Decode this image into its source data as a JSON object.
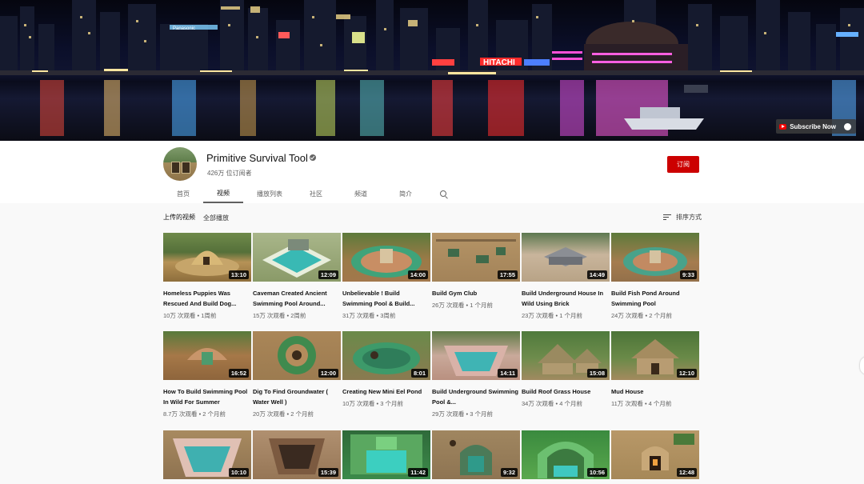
{
  "banner": {
    "subscribe_now_label": "Subscribe Now",
    "sign_hitachi": "HITACHI",
    "sign_panasonic": "Panasonic"
  },
  "channel": {
    "name": "Primitive Survival Tool",
    "subscribers": "426万 位订阅者",
    "subscribe_label": "订阅",
    "accent_color": "#cc0000"
  },
  "tabs": [
    {
      "label": "首页"
    },
    {
      "label": "视频",
      "active": true
    },
    {
      "label": "播放列表"
    },
    {
      "label": "社区"
    },
    {
      "label": "频道"
    },
    {
      "label": "简介"
    }
  ],
  "section": {
    "title": "上传的视频",
    "play_all": "全部播放",
    "sort_label": "排序方式"
  },
  "videos": [
    {
      "title": "Homeless Puppies Was Rescued And Build Dog...",
      "meta": "10万 次观看 • 1周前",
      "duration": "13:10"
    },
    {
      "title": "Caveman Created Ancient Swimming Pool Around...",
      "meta": "15万 次观看 • 2周前",
      "duration": "12:09"
    },
    {
      "title": "Unbelievable ! Build Swimming Pool & Build...",
      "meta": "31万 次观看 • 3周前",
      "duration": "14:00"
    },
    {
      "title": "Build Gym Club",
      "meta": "26万 次观看 • 1 个月前",
      "duration": "17:55"
    },
    {
      "title": "Build Underground House In Wild Using Brick",
      "meta": "23万 次观看 • 1 个月前",
      "duration": "14:49"
    },
    {
      "title": "Build Fish Pond Around Swimming Pool",
      "meta": "24万 次观看 • 2 个月前",
      "duration": "9:33"
    },
    {
      "title": "How To Build Swimming Pool In Wild For Summer",
      "meta": "8.7万 次观看 • 2 个月前",
      "duration": "16:52"
    },
    {
      "title": "Dig To Find Groundwater ( Water Well )",
      "meta": "20万 次观看 • 2 个月前",
      "duration": "12:00"
    },
    {
      "title": "Creating New Mini Eel Pond",
      "meta": "10万 次观看 • 3 个月前",
      "duration": "8:01"
    },
    {
      "title": "Build Underground Swimming Pool &...",
      "meta": "29万 次观看 • 3 个月前",
      "duration": "14:11"
    },
    {
      "title": "Build Roof Grass House",
      "meta": "34万 次观看 • 4 个月前",
      "duration": "15:08"
    },
    {
      "title": "Mud House",
      "meta": "11万 次观看 • 4 个月前",
      "duration": "12:10"
    },
    {
      "title": "",
      "meta": "",
      "duration": "10:10"
    },
    {
      "title": "",
      "meta": "",
      "duration": "15:39"
    },
    {
      "title": "",
      "meta": "",
      "duration": "11:42"
    },
    {
      "title": "",
      "meta": "",
      "duration": "9:32"
    },
    {
      "title": "",
      "meta": "",
      "duration": "10:56"
    },
    {
      "title": "",
      "meta": "",
      "duration": "12:48"
    }
  ]
}
